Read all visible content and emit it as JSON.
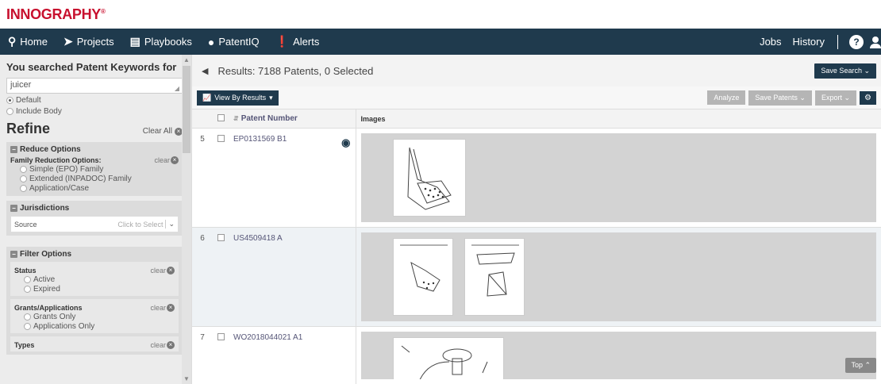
{
  "brand": {
    "name": "INNOGRAPHY",
    "mark": "®"
  },
  "nav": {
    "items": [
      {
        "icon": "search-icon",
        "label": "Home"
      },
      {
        "icon": "folder-icon",
        "label": "Projects"
      },
      {
        "icon": "playbook-icon",
        "label": "Playbooks"
      },
      {
        "icon": "lightbulb-icon",
        "label": "PatentIQ"
      },
      {
        "icon": "alert-icon",
        "label": "Alerts"
      }
    ],
    "right": {
      "jobs": "Jobs",
      "history": "History",
      "help": "?"
    }
  },
  "sidebar": {
    "searched_title": "You searched Patent Keywords for",
    "keyword": "juicer",
    "search_options": [
      "Default",
      "Include Body"
    ],
    "selected_option": "Default",
    "refine_title": "Refine",
    "clear_all": "Clear All",
    "reduce": {
      "title": "Reduce Options",
      "family_label": "Family Reduction Options:",
      "clear": "clear",
      "options": [
        "Simple (EPO) Family",
        "Extended (INPADOC) Family",
        "Application/Case"
      ]
    },
    "jurisdictions": {
      "title": "Jurisdictions",
      "source_label": "Source",
      "source_placeholder": "Click to Select"
    },
    "filter": {
      "title": "Filter Options",
      "status": {
        "label": "Status",
        "clear": "clear",
        "options": [
          "Active",
          "Expired"
        ]
      },
      "grants": {
        "label": "Grants/Applications",
        "clear": "clear",
        "options": [
          "Grants Only",
          "Applications Only"
        ]
      },
      "types": {
        "label": "Types",
        "clear": "clear"
      }
    }
  },
  "results": {
    "summary": "Results: 7188 Patents, 0 Selected",
    "save_search": "Save Search",
    "view_by": "View By Results",
    "analyze": "Analyze",
    "save_patents": "Save Patents",
    "export": "Export",
    "columns": {
      "patent_number": "Patent Number",
      "images": "Images"
    },
    "rows": [
      {
        "num": "5",
        "patent": "EP0131569 B1",
        "thumbs": 1
      },
      {
        "num": "6",
        "patent": "US4509418 A",
        "thumbs": 2
      },
      {
        "num": "7",
        "patent": "WO2018044021 A1",
        "thumbs": 1
      }
    ],
    "top_button": "Top"
  },
  "colors": {
    "nav_bg": "#1f3a4d",
    "brand_red": "#c8102e",
    "sidebar_bg": "#ececec",
    "image_bg": "#d3d3d3"
  }
}
